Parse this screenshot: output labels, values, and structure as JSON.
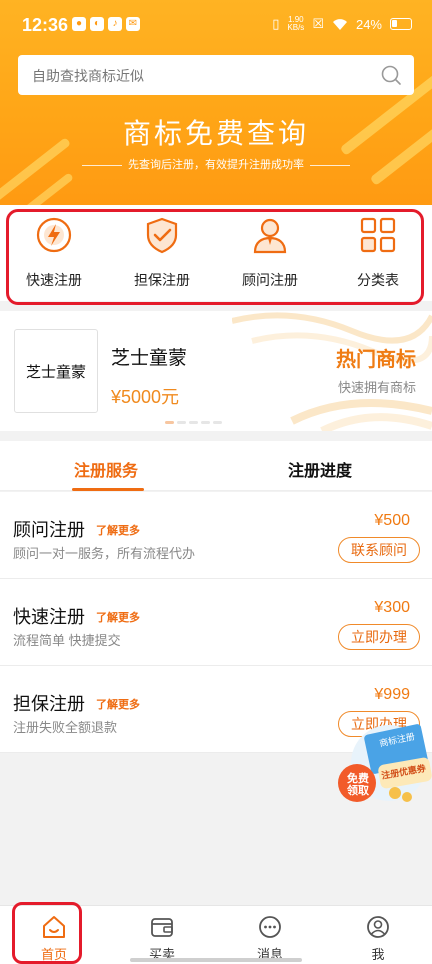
{
  "status_bar": {
    "time": "12:36",
    "net_speed_value": "1.90",
    "net_speed_unit": "KB/s",
    "battery": "24%"
  },
  "search": {
    "placeholder": "自助查找商标近似"
  },
  "hero": {
    "title": "商标免费查询",
    "subtitle": "先查询后注册，有效提升注册成功率"
  },
  "quick_entries": [
    {
      "label": "快速注册",
      "icon": "lightning-icon"
    },
    {
      "label": "担保注册",
      "icon": "shield-check-icon"
    },
    {
      "label": "顾问注册",
      "icon": "consultant-icon"
    },
    {
      "label": "分类表",
      "icon": "grid-icon"
    }
  ],
  "hot_card": {
    "thumb_text": "芝士童蒙",
    "name": "芝士童蒙",
    "price": "¥5000元",
    "tag": "热门商标",
    "tag_sub": "快速拥有商标"
  },
  "tabs": [
    {
      "label": "注册服务",
      "active": true
    },
    {
      "label": "注册进度",
      "active": false
    }
  ],
  "services": [
    {
      "title": "顾问注册",
      "more": "了解更多",
      "desc": "顾问一对一服务，所有流程代办",
      "price": "¥500",
      "button": "联系顾问"
    },
    {
      "title": "快速注册",
      "more": "了解更多",
      "desc": "流程简单 快捷提交",
      "price": "¥300",
      "button": "立即办理"
    },
    {
      "title": "担保注册",
      "more": "了解更多",
      "desc": "注册失败全额退款",
      "price": "¥999",
      "button": "立即办理"
    }
  ],
  "promo": {
    "badge": "免费领取",
    "card": "注册优惠券",
    "ribbon": "商标注册"
  },
  "bottom_nav": [
    {
      "label": "首页",
      "icon": "home-icon",
      "active": true
    },
    {
      "label": "买卖",
      "icon": "wallet-icon",
      "active": false
    },
    {
      "label": "消息",
      "icon": "message-icon",
      "active": false
    },
    {
      "label": "我",
      "icon": "profile-icon",
      "active": false
    }
  ],
  "colors": {
    "accent": "#ef6c12",
    "banner": "#ffa617",
    "highlight_box": "#e41b2b"
  }
}
